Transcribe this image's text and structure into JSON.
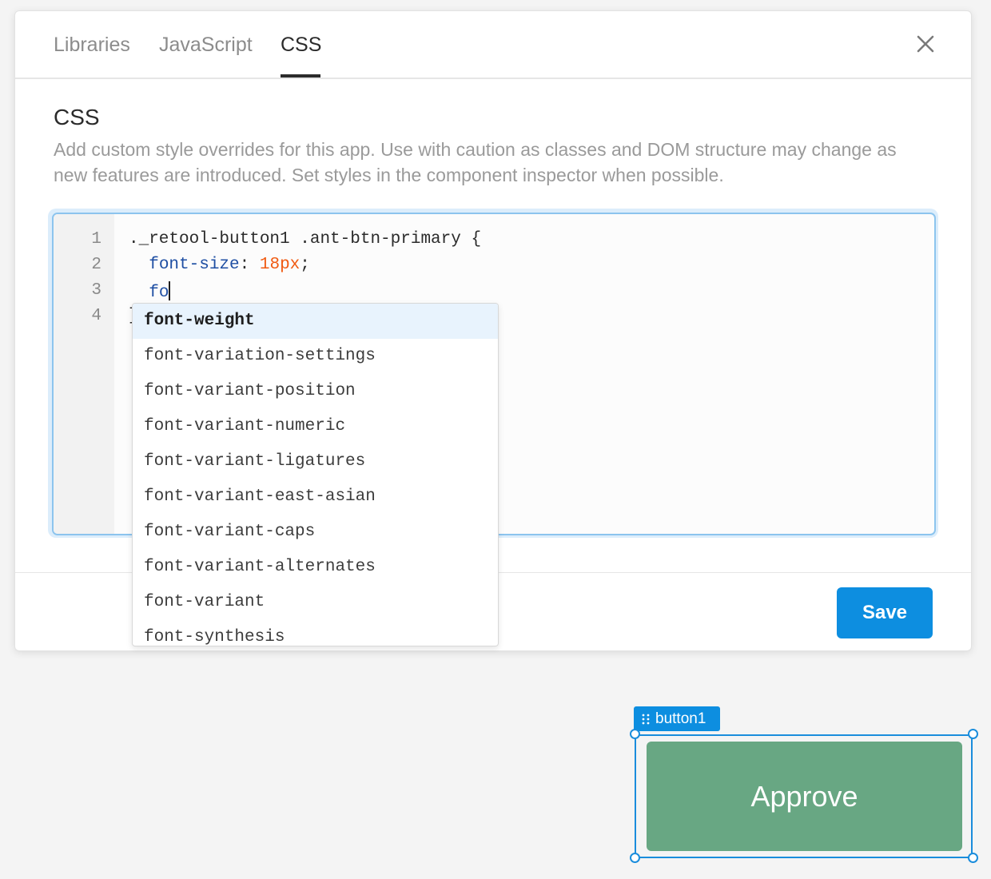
{
  "tabs": [
    {
      "label": "Libraries",
      "active": false
    },
    {
      "label": "JavaScript",
      "active": false
    },
    {
      "label": "CSS",
      "active": true
    }
  ],
  "icons": {
    "close": "close-icon",
    "drag": "drag-handle-icon"
  },
  "section": {
    "title": "CSS",
    "description": "Add custom style overrides for this app. Use with caution as classes and DOM structure may change as new features are introduced. Set styles in the component inspector when possible."
  },
  "editor": {
    "line_numbers": [
      "1",
      "2",
      "3",
      "4"
    ],
    "lines": {
      "l1": "._retool-button1 .ant-btn-primary {",
      "l2_indent": "  ",
      "l2_prop": "font-size",
      "l2_colon": ": ",
      "l2_value": "18px",
      "l2_semi": ";",
      "l3_indent": "  ",
      "l3_typed": "fo",
      "l4": "}"
    }
  },
  "autocomplete": {
    "items": [
      "font-weight",
      "font-variation-settings",
      "font-variant-position",
      "font-variant-numeric",
      "font-variant-ligatures",
      "font-variant-east-asian",
      "font-variant-caps",
      "font-variant-alternates",
      "font-variant",
      "font-synthesis"
    ],
    "selected_index": 0
  },
  "footer": {
    "save_label": "Save"
  },
  "canvas": {
    "component_name": "button1",
    "button_label": "Approve"
  },
  "colors": {
    "accent": "#0d8ee0",
    "approve_button": "#68a783",
    "css_property": "#1f4fa3",
    "css_number": "#f05a12"
  }
}
